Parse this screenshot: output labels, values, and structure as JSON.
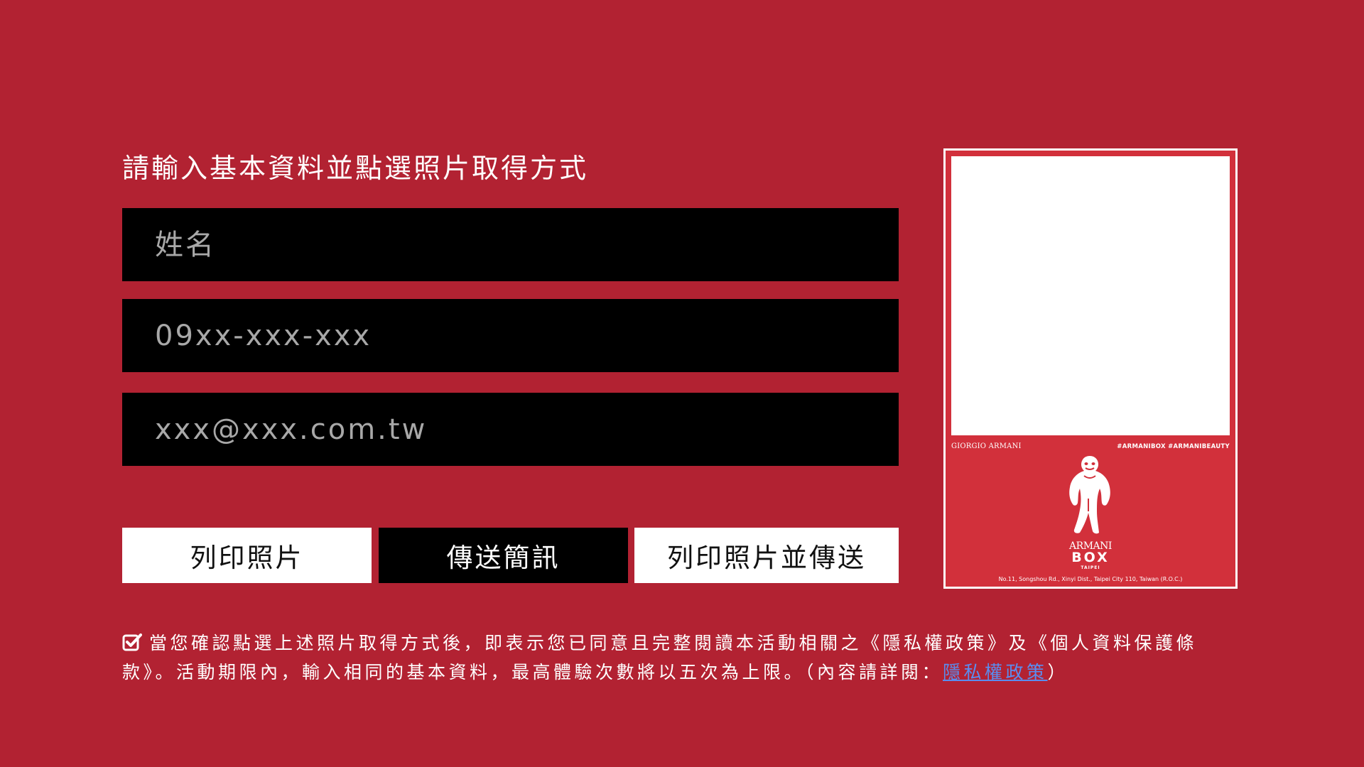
{
  "form": {
    "title": "請輸入基本資料並點選照片取得方式",
    "name_placeholder": "姓名",
    "phone_placeholder": "09xx-xxx-xxx",
    "email_placeholder": "xxx@xxx.com.tw"
  },
  "buttons": {
    "print": "列印照片",
    "send_sms": "傳送簡訊",
    "print_and_send": "列印照片並傳送"
  },
  "consent": {
    "checked": true,
    "text": "當您確認點選上述照片取得方式後，即表示您已同意且完整閱讀本活動相關之《隱私權政策》及《個人資料保護條款》。活動期限內，輸入相同的基本資料，最高體驗次數將以五次為上限。（內容請詳閱：",
    "link_label": "隱私權政策",
    "closing": "）"
  },
  "preview": {
    "brand": "GIORGIO ARMANI",
    "hashtags": "#ARMANIBOX  #ARMANIBEAUTY",
    "logo_top": "ARMANI",
    "logo_box": "BOX",
    "logo_city": "TAIPEI",
    "address": "No.11, Songshou Rd., Xinyi Dist., Taipei City 110, Taiwan (R.O.C.)",
    "logo_icon": "gorilla-icon"
  },
  "colors": {
    "background": "#b22232",
    "card": "#d2303b",
    "link": "#5a8df0"
  }
}
